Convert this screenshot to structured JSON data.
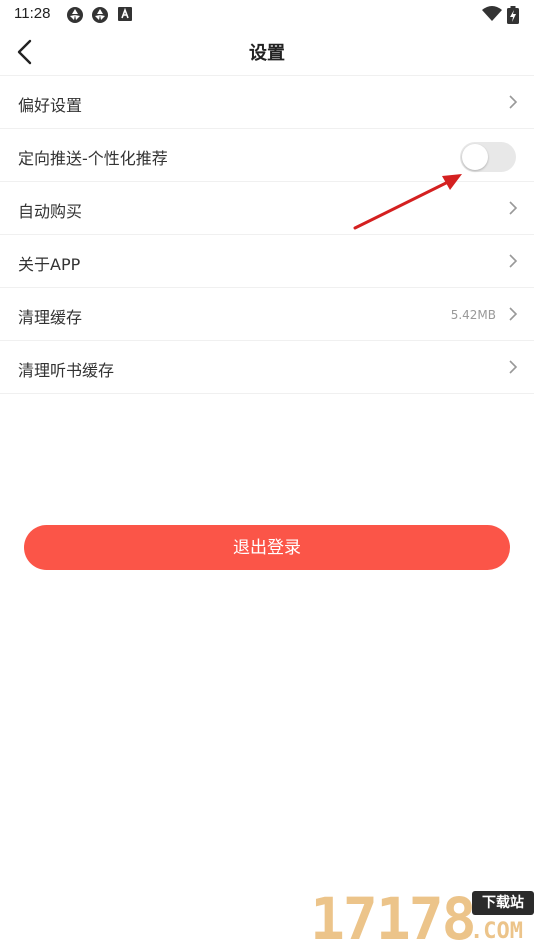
{
  "status_bar": {
    "time": "11:28",
    "icons": [
      "aperture-icon",
      "aperture-icon",
      "app-badge-icon",
      "wifi-icon",
      "battery-charging-icon"
    ]
  },
  "header": {
    "title": "设置"
  },
  "settings": {
    "items": [
      {
        "label": "偏好设置",
        "type": "link"
      },
      {
        "label": "定向推送-个性化推荐",
        "type": "toggle",
        "enabled": false
      },
      {
        "label": "自动购买",
        "type": "link"
      },
      {
        "label": "关于APP",
        "type": "link"
      },
      {
        "label": "清理缓存",
        "type": "link",
        "value": "5.42MB"
      },
      {
        "label": "清理听书缓存",
        "type": "link"
      }
    ]
  },
  "logout": {
    "label": "退出登录"
  },
  "colors": {
    "accent": "#fb5548",
    "annotation_arrow": "#d42020",
    "toggle_off": "#e8e8e8"
  },
  "watermark": {
    "number": "17178",
    "tag": "下载站",
    "suffix": ".COM"
  }
}
